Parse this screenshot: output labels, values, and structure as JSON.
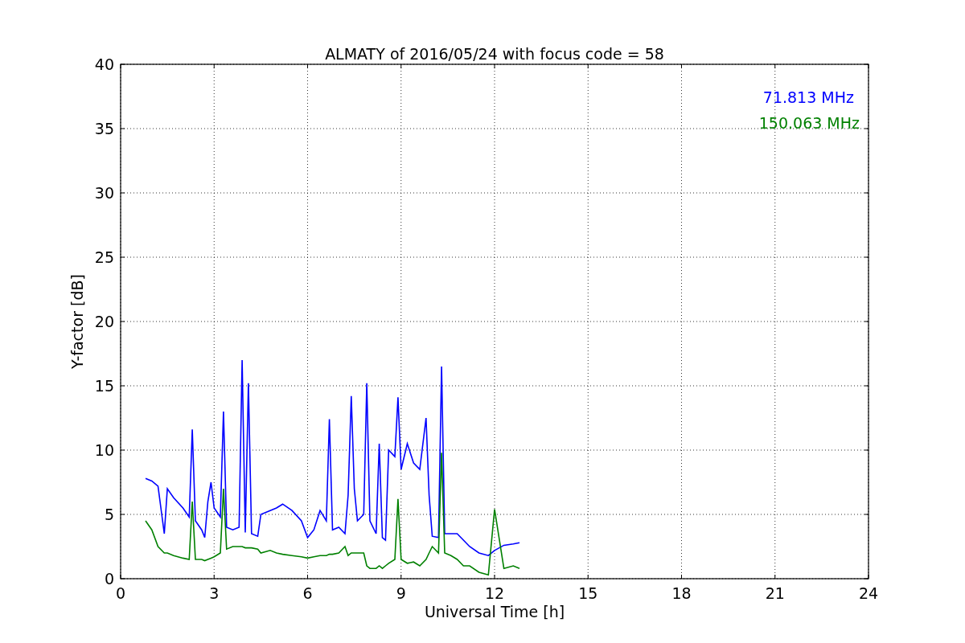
{
  "chart_data": {
    "type": "line",
    "title": "ALMATY of 2016/05/24 with focus code = 58",
    "xlabel": "Universal Time [h]",
    "ylabel": "Y-factor [dB]",
    "grid": true,
    "xlim": [
      0,
      24
    ],
    "ylim": [
      0,
      40
    ],
    "xticks": [
      0,
      3,
      6,
      9,
      12,
      15,
      18,
      21,
      24
    ],
    "yticks": [
      0,
      5,
      10,
      15,
      20,
      25,
      30,
      35,
      40
    ],
    "x": [
      0.8,
      1.0,
      1.2,
      1.4,
      1.5,
      1.7,
      2.0,
      2.2,
      2.3,
      2.4,
      2.6,
      2.7,
      2.8,
      2.9,
      3.0,
      3.2,
      3.3,
      3.4,
      3.6,
      3.8,
      3.9,
      4.0,
      4.1,
      4.2,
      4.4,
      4.5,
      4.8,
      5.0,
      5.2,
      5.5,
      5.8,
      6.0,
      6.2,
      6.4,
      6.6,
      6.7,
      6.8,
      7.0,
      7.2,
      7.3,
      7.4,
      7.5,
      7.6,
      7.8,
      7.9,
      8.0,
      8.2,
      8.3,
      8.4,
      8.5,
      8.6,
      8.8,
      8.9,
      9.0,
      9.2,
      9.4,
      9.6,
      9.8,
      9.9,
      10.0,
      10.2,
      10.3,
      10.4,
      10.6,
      10.8,
      11.0,
      11.2,
      11.5,
      11.8,
      12.0,
      12.3,
      12.6,
      12.8
    ],
    "series": [
      {
        "name": "71.813 MHz",
        "color": "#0000ff",
        "values": [
          7.8,
          7.6,
          7.2,
          3.5,
          7.0,
          6.3,
          5.5,
          4.8,
          11.6,
          4.5,
          3.8,
          3.2,
          6.0,
          7.5,
          5.5,
          4.8,
          13.0,
          4.0,
          3.8,
          4.0,
          17.0,
          3.6,
          15.2,
          3.5,
          3.3,
          5.0,
          5.3,
          5.5,
          5.8,
          5.3,
          4.5,
          3.2,
          3.8,
          5.3,
          4.5,
          12.4,
          3.8,
          4.0,
          3.5,
          6.5,
          14.2,
          7.0,
          4.5,
          5.0,
          15.2,
          4.5,
          3.5,
          10.5,
          3.2,
          3.0,
          10.0,
          9.5,
          14.1,
          8.5,
          10.5,
          9.0,
          8.5,
          12.5,
          6.5,
          3.3,
          3.2,
          16.5,
          3.5,
          3.5,
          3.5,
          3.0,
          2.5,
          2.0,
          1.8,
          2.2,
          2.6,
          2.7,
          2.8
        ]
      },
      {
        "name": "150.063 MHz",
        "color": "#008000",
        "values": [
          4.5,
          3.8,
          2.5,
          2.0,
          2.0,
          1.8,
          1.6,
          1.5,
          6.0,
          1.5,
          1.5,
          1.4,
          1.5,
          1.6,
          1.7,
          2.0,
          7.0,
          2.3,
          2.5,
          2.5,
          2.5,
          2.4,
          2.4,
          2.4,
          2.3,
          2.0,
          2.2,
          2.0,
          1.9,
          1.8,
          1.7,
          1.6,
          1.7,
          1.8,
          1.8,
          1.9,
          1.9,
          2.0,
          2.5,
          1.8,
          2.0,
          2.0,
          2.0,
          2.0,
          1.0,
          0.8,
          0.8,
          1.0,
          0.8,
          1.0,
          1.2,
          1.5,
          6.2,
          1.5,
          1.2,
          1.3,
          1.0,
          1.5,
          2.0,
          2.5,
          2.0,
          9.8,
          2.0,
          1.8,
          1.5,
          1.0,
          1.0,
          0.5,
          0.3,
          5.4,
          0.8,
          1.0,
          0.8
        ]
      }
    ]
  }
}
